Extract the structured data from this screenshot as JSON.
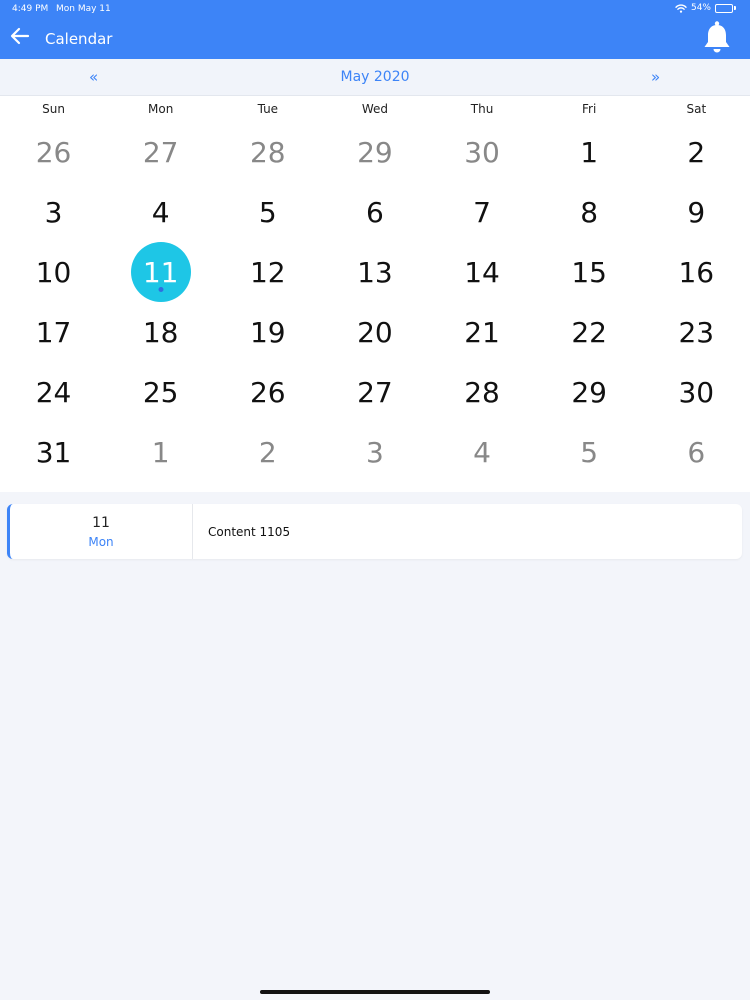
{
  "status_bar": {
    "time": "4:49 PM",
    "date": "Mon May 11",
    "battery": "54%",
    "battery_level": 0.54
  },
  "navbar": {
    "title": "Calendar",
    "back_icon": "arrow-left-icon",
    "bell_icon": "bell-icon"
  },
  "month_nav": {
    "prev": "«",
    "title": "May 2020",
    "next": "»"
  },
  "calendar": {
    "weekdays": [
      "Sun",
      "Mon",
      "Tue",
      "Wed",
      "Thu",
      "Fri",
      "Sat"
    ],
    "days": [
      {
        "label": "26",
        "in_month": false
      },
      {
        "label": "27",
        "in_month": false
      },
      {
        "label": "28",
        "in_month": false
      },
      {
        "label": "29",
        "in_month": false
      },
      {
        "label": "30",
        "in_month": false
      },
      {
        "label": "1",
        "in_month": true
      },
      {
        "label": "2",
        "in_month": true
      },
      {
        "label": "3",
        "in_month": true
      },
      {
        "label": "4",
        "in_month": true
      },
      {
        "label": "5",
        "in_month": true
      },
      {
        "label": "6",
        "in_month": true
      },
      {
        "label": "7",
        "in_month": true
      },
      {
        "label": "8",
        "in_month": true
      },
      {
        "label": "9",
        "in_month": true
      },
      {
        "label": "10",
        "in_month": true
      },
      {
        "label": "11",
        "in_month": true,
        "selected": true,
        "has_event": true
      },
      {
        "label": "12",
        "in_month": true
      },
      {
        "label": "13",
        "in_month": true
      },
      {
        "label": "14",
        "in_month": true
      },
      {
        "label": "15",
        "in_month": true
      },
      {
        "label": "16",
        "in_month": true
      },
      {
        "label": "17",
        "in_month": true
      },
      {
        "label": "18",
        "in_month": true
      },
      {
        "label": "19",
        "in_month": true
      },
      {
        "label": "20",
        "in_month": true
      },
      {
        "label": "21",
        "in_month": true
      },
      {
        "label": "22",
        "in_month": true
      },
      {
        "label": "23",
        "in_month": true
      },
      {
        "label": "24",
        "in_month": true
      },
      {
        "label": "25",
        "in_month": true
      },
      {
        "label": "26",
        "in_month": true
      },
      {
        "label": "27",
        "in_month": true
      },
      {
        "label": "28",
        "in_month": true
      },
      {
        "label": "29",
        "in_month": true
      },
      {
        "label": "30",
        "in_month": true
      },
      {
        "label": "31",
        "in_month": true
      },
      {
        "label": "1",
        "in_month": false
      },
      {
        "label": "2",
        "in_month": false
      },
      {
        "label": "3",
        "in_month": false
      },
      {
        "label": "4",
        "in_month": false
      },
      {
        "label": "5",
        "in_month": false
      },
      {
        "label": "6",
        "in_month": false
      }
    ]
  },
  "event": {
    "day": "11",
    "weekday": "Mon",
    "content": "Content 1105"
  },
  "colors": {
    "primary": "#3d84f7",
    "selected_day": "#1ec6e6",
    "event_dot": "#2f6fe0",
    "muted_day": "#888888"
  }
}
